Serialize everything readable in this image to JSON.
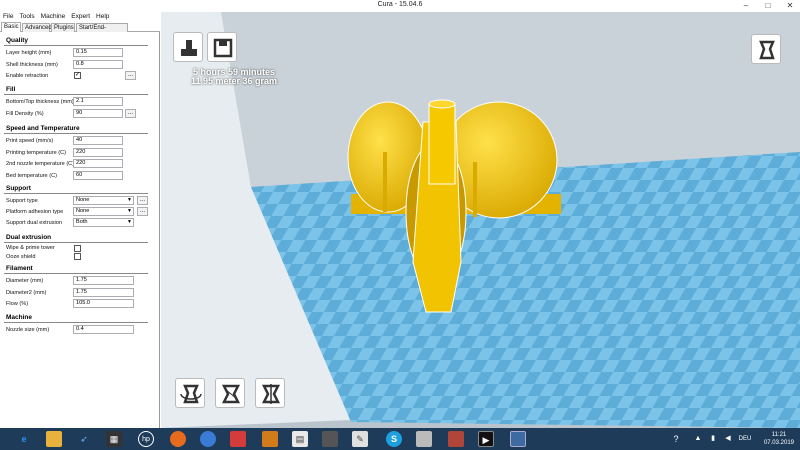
{
  "window": {
    "title": "Cura - 15.04.6",
    "minimize": "–",
    "maximize": "□",
    "close": "✕"
  },
  "menu": [
    "File",
    "Tools",
    "Machine",
    "Expert",
    "Help"
  ],
  "tabs": [
    "Basic",
    "Advanced",
    "Plugins",
    "Start/End-GCode"
  ],
  "sections": {
    "quality": "Quality",
    "fill": "Fill",
    "speed": "Speed and Temperature",
    "support": "Support",
    "dual": "Dual extrusion",
    "filament": "Filament",
    "machine": "Machine"
  },
  "fields": {
    "layer_height": {
      "label": "Layer height (mm)",
      "value": "0.15"
    },
    "shell_thickness": {
      "label": "Shell thickness (mm)",
      "value": "0.8"
    },
    "enable_retraction": {
      "label": "Enable retraction",
      "checked": "✓"
    },
    "bottom_top": {
      "label": "Bottom/Top thickness (mm)",
      "value": "2.1"
    },
    "fill_density": {
      "label": "Fill Density (%)",
      "value": "90"
    },
    "print_speed": {
      "label": "Print speed (mm/s)",
      "value": "40"
    },
    "print_temp": {
      "label": "Printing temperature (C)",
      "value": "220"
    },
    "nozzle2_temp": {
      "label": "2nd nozzle temperature (C)",
      "value": "220"
    },
    "bed_temp": {
      "label": "Bed temperature (C)",
      "value": "60"
    },
    "support_type": {
      "label": "Support type",
      "value": "None"
    },
    "adhesion": {
      "label": "Platform adhesion type",
      "value": "None"
    },
    "support_dual": {
      "label": "Support dual extrusion",
      "value": "Both"
    },
    "wipe_tower": {
      "label": "Wipe & prime tower"
    },
    "ooze_shield": {
      "label": "Ooze shield"
    },
    "diameter": {
      "label": "Diameter (mm)",
      "value": "1.75"
    },
    "diameter2": {
      "label": "Diameter2 (mm)",
      "value": "1.75"
    },
    "flow": {
      "label": "Flow (%)",
      "value": "105.0"
    },
    "nozzle_size": {
      "label": "Nozzle size (mm)",
      "value": "0.4"
    }
  },
  "dots": "...",
  "viewport": {
    "time": "5 hours 59 minutes",
    "material": "11.95 meter 36 gram"
  },
  "taskbar": {
    "time": "11:21",
    "date": "07.03.2019",
    "lang": "DEU"
  },
  "colors": {
    "model": "#f5c400",
    "bed": "#6fb6e0",
    "taskbar": "#1e3c5a"
  }
}
